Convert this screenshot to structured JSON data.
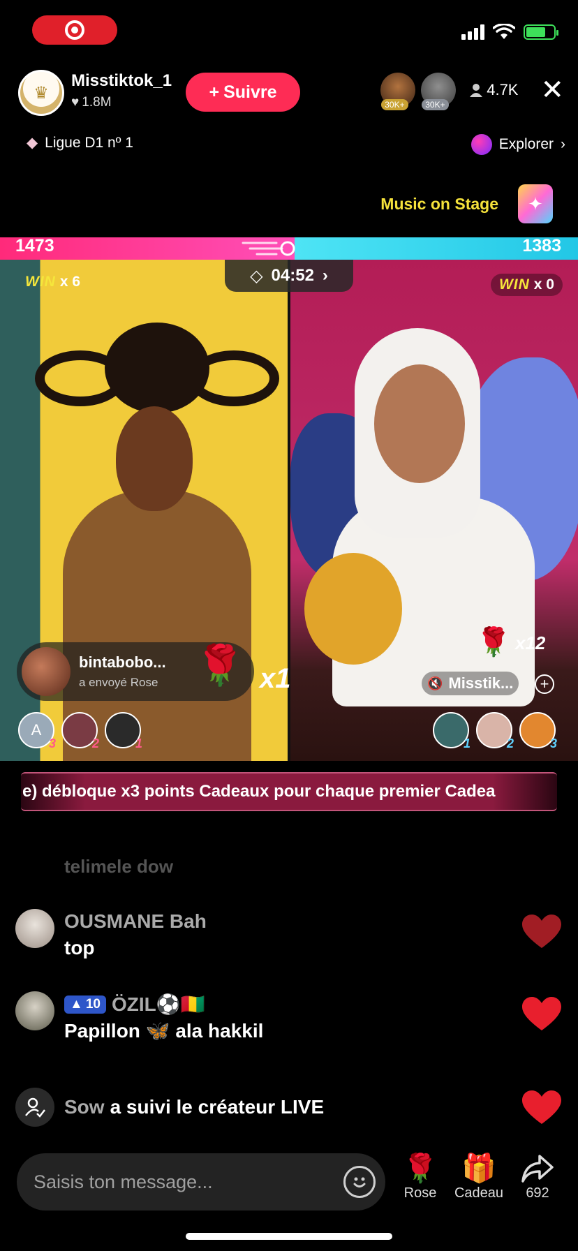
{
  "host": {
    "name": "Misstiktok_1",
    "likes": "1.8M",
    "follow_label": "Suivre"
  },
  "viewers": {
    "badge1": "30K+",
    "badge2": "30K+",
    "count": "4.7K"
  },
  "league": {
    "label": "Ligue D1 nº 1"
  },
  "explore": {
    "label": "Explorer"
  },
  "music": {
    "label": "Music on Stage"
  },
  "battle": {
    "score_left": "1473",
    "score_right": "1383",
    "timer": "04:52",
    "win_label": "WIN",
    "win_left": "x 6",
    "win_right": "x 0",
    "colors": {
      "left": "#ff2a7a",
      "right": "#3ed8ee"
    }
  },
  "gift_notice": {
    "user": "bintabobo...",
    "action": "a envoyé  Rose",
    "multiplier": "x1"
  },
  "right_panel": {
    "multiplier": "x12",
    "tag": "Misstik..."
  },
  "top_gifters_left": [
    {
      "initial": "A",
      "rank": "3"
    },
    {
      "initial": "",
      "rank": "2"
    },
    {
      "initial": "",
      "rank": "1"
    }
  ],
  "top_gifters_right": [
    {
      "rank": "1"
    },
    {
      "rank": "2"
    },
    {
      "rank": "3"
    }
  ],
  "ticker": {
    "text": "e) débloque x3 points Cadeaux pour chaque premier Cadea"
  },
  "comments": {
    "faded": "telimele dow",
    "c1": {
      "user": "OUSMANE Bah",
      "text": "top"
    },
    "c2": {
      "level": "10",
      "user": "ÖZIL⚽🇬🇳",
      "text": "Papillon 🦋 ala hakkil"
    },
    "c3": {
      "user": "Sow",
      "text": "a suivi le créateur LIVE"
    }
  },
  "input": {
    "placeholder": "Saisis ton message..."
  },
  "actions": {
    "rose": "Rose",
    "gift": "Cadeau",
    "share": "692"
  }
}
